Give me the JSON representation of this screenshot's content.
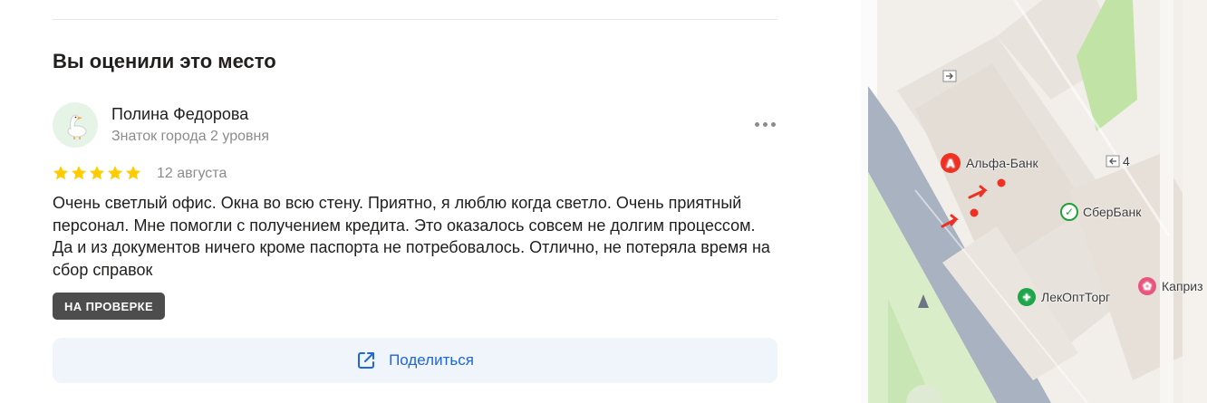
{
  "section": {
    "title": "Вы оценили это место"
  },
  "review": {
    "author_name": "Полина Федорова",
    "author_level": "Знаток города 2 уровня",
    "rating": 5,
    "date": "12 августа",
    "text": "Очень светлый офис. Окна во всю стену. Приятно, я люблю когда светло. Очень приятный персонал. Мне помогли с получением кредита. Это оказалось совсем не долгим процессом. Да и из документов ничего кроме паспорта не потребовалось. Отлично, не потеряла время на сбор справок",
    "status_badge": "НА ПРОВЕРКЕ",
    "more_icon": "more-horizontal-icon"
  },
  "share": {
    "label": "Поделиться",
    "icon": "external-link-icon"
  },
  "map": {
    "labels": {
      "alfa": "Альфа-Банк",
      "sber": "СберБанк",
      "lekopt": "ЛекОптТорг",
      "kapriz": "Каприз",
      "entrance_num": "4"
    }
  },
  "colors": {
    "star": "#fc0",
    "badge_bg": "#4d4d4d",
    "share_bg": "#f0f4fb",
    "share_text": "#1c66e0",
    "alfa_red": "#ef3124",
    "sber_green": "#21a038",
    "pharmacy_green": "#1fa64a",
    "kapriz_pink": "#e8567d"
  }
}
